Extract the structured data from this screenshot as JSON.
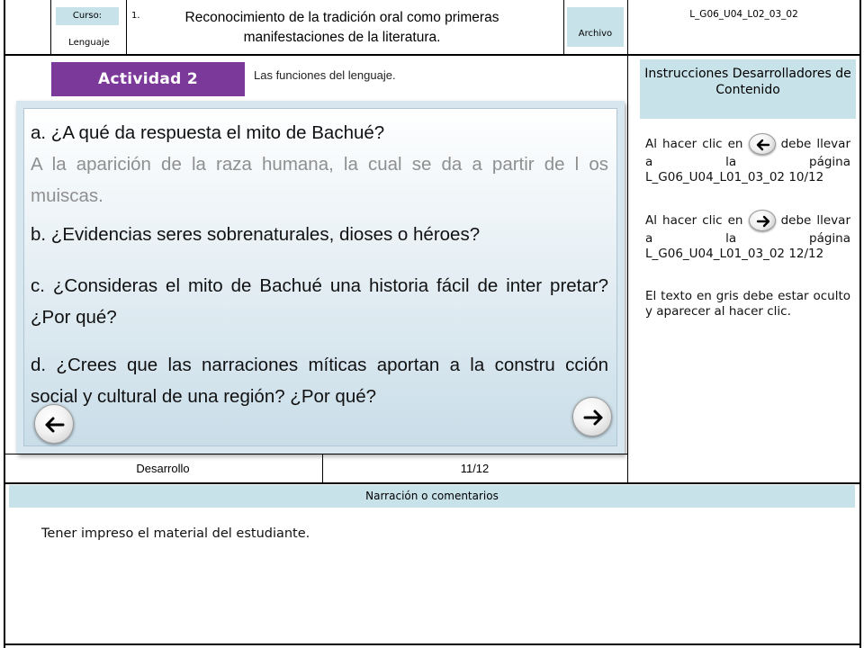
{
  "header": {
    "course_label": "Curso:",
    "subject": "Lenguaje",
    "number": "1.",
    "title": "Reconocimiento de la tradición oral como primeras manifestaciones de la literatura.",
    "file_label": "Archivo",
    "code": "L_G06_U04_L02_03_02"
  },
  "activity": {
    "badge": "Actividad 2",
    "subtitle": "Las funciones del lenguaje."
  },
  "card": {
    "q_a": "a. ¿A qué da respuesta el mito de Bachué?",
    "a_a": "A la aparición de la raza humana, la cual se da a partir de l os muiscas.",
    "q_b": "b. ¿Evidencias seres sobrenaturales, dioses o héroes?",
    "q_c": "c. ¿Consideras el mito de Bachué una historia fácil de inter pretar? ¿Por qué?",
    "q_d": "d. ¿Crees que las narraciones míticas aportan a la constru cción social y cultural de una región? ¿Por qué?"
  },
  "instructions": {
    "title": "Instrucciones Desarrolladores de Contenido",
    "p1_before": "Al hacer clic en",
    "p1_after": "debe llevar a la página L_G06_U04_L01_03_02 10/12",
    "p2_before": "Al hacer clic en",
    "p2_after": "debe llevar a la página L_G06_U04_L01_03_02 12/12",
    "p3": "El texto en gris debe estar oculto y aparecer al hacer clic."
  },
  "footer_row": {
    "stage": "Desarrollo",
    "page": "11/12"
  },
  "narration": {
    "label": "Narración o comentarios",
    "text": "Tener impreso el material del estudiante."
  },
  "icons": {
    "prev": "arrow-left-icon",
    "next": "arrow-right-icon"
  },
  "colors": {
    "accent_purple": "#7b3a9a",
    "label_bg": "#c8e2ea",
    "answer_gray": "#8f8f8f"
  }
}
